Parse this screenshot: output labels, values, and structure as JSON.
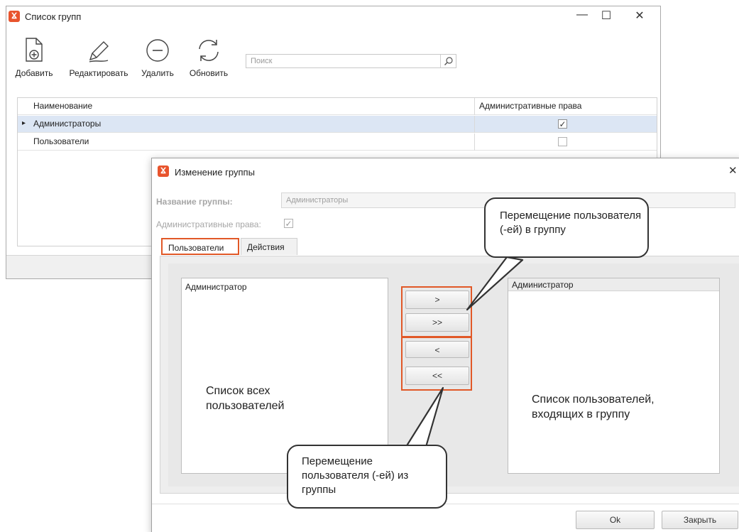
{
  "main_window": {
    "title": "Список групп",
    "controls": {
      "minimize": "—",
      "maximize": "☐",
      "close": "✕"
    },
    "toolbar": {
      "add_label": "Добавить",
      "edit_label": "Редактировать",
      "delete_label": "Удалить",
      "refresh_label": "Обновить"
    },
    "search": {
      "placeholder": "Поиск"
    },
    "table": {
      "columns": [
        "Наименование",
        "Административные права"
      ],
      "rows": [
        {
          "name": "Администраторы",
          "admin_rights": true,
          "selected": true,
          "checkmark": "✓"
        },
        {
          "name": "Пользователи",
          "admin_rights": false,
          "selected": false,
          "checkmark": ""
        }
      ],
      "row_indicator": "▸"
    }
  },
  "dialog": {
    "title": "Изменение группы",
    "close": "✕",
    "group_name_label": "Название группы:",
    "group_name_value": "Администраторы",
    "admin_rights_label": "Административные права:",
    "admin_rights_checkmark": "✓",
    "tabs": [
      {
        "label": "Пользователи",
        "active": true
      },
      {
        "label": "Действия",
        "active": false
      }
    ],
    "left_list": {
      "items": [
        "Администратор"
      ]
    },
    "right_list": {
      "header": "Администратор"
    },
    "move_buttons": {
      "add_one": ">",
      "add_all": ">>",
      "remove_one": "<",
      "remove_all": "<<"
    },
    "ok_label": "Ok",
    "close_label": "Закрыть"
  },
  "annotations": {
    "all_users": "Список всех пользователей",
    "group_users": "Список пользователей, входящих в группу",
    "move_in": "Перемещение пользователя (-ей) в группу",
    "move_out": "Перемещение пользователя (-ей) из группы"
  },
  "colors": {
    "accent_orange": "#e15827",
    "selected_row": "#dce6f4",
    "dialog_panel": "#eeeeee"
  }
}
